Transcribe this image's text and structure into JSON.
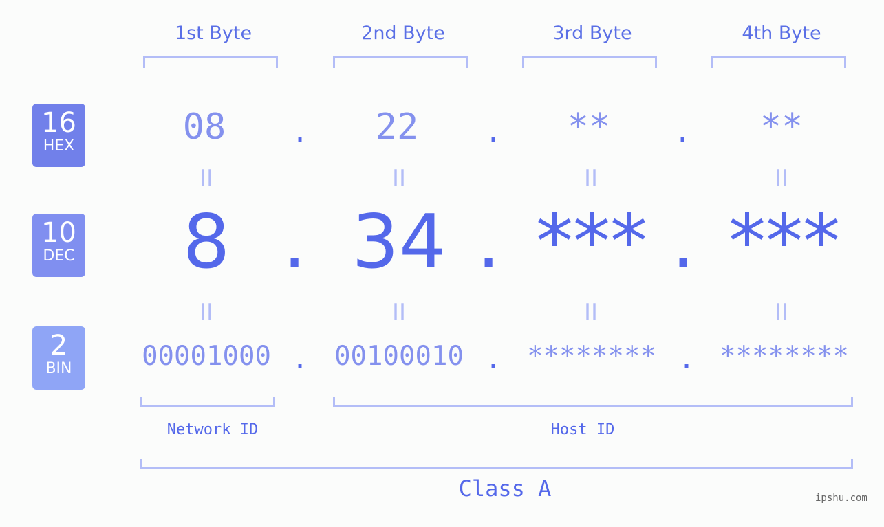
{
  "bytes": [
    {
      "header": "1st Byte",
      "hex": "08",
      "dec": "8",
      "bin": "00001000"
    },
    {
      "header": "2nd Byte",
      "hex": "22",
      "dec": "34",
      "bin": "00100010"
    },
    {
      "header": "3rd Byte",
      "hex": "**",
      "dec": "***",
      "bin": "********"
    },
    {
      "header": "4th Byte",
      "hex": "**",
      "dec": "***",
      "bin": "********"
    }
  ],
  "badges": {
    "hex": {
      "num": "16",
      "label": "HEX",
      "color": "#7180ea"
    },
    "dec": {
      "num": "10",
      "label": "DEC",
      "color": "#808ff0"
    },
    "bin": {
      "num": "2",
      "label": "BIN",
      "color": "#8fa5f6"
    }
  },
  "separator": ".",
  "equals": "II",
  "network_id": "Network ID",
  "host_id": "Host ID",
  "class_label": "Class A",
  "watermark": "ipshu.com"
}
